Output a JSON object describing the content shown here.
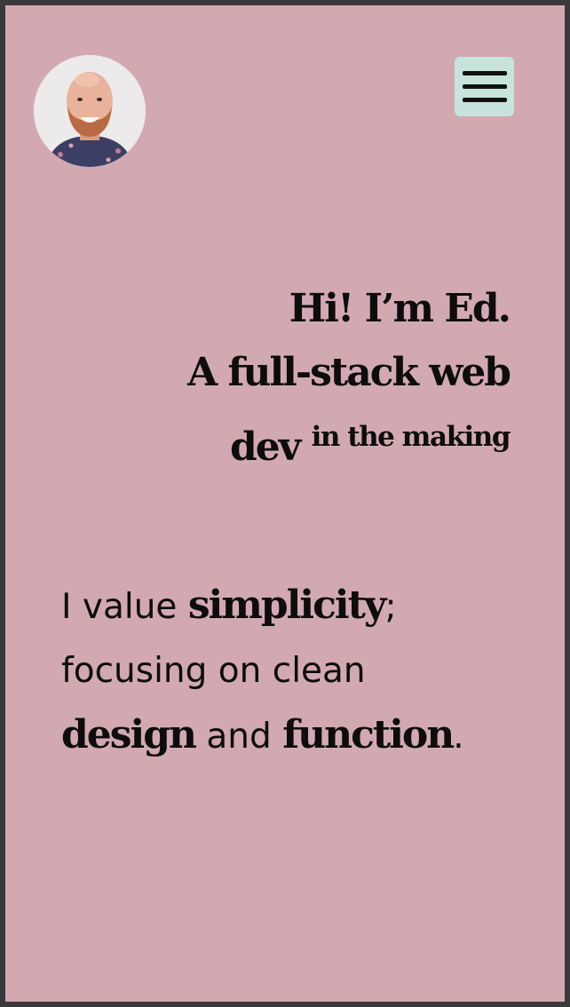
{
  "header": {
    "avatar_alt": "Ed",
    "menu_icon": "hamburger-menu-icon"
  },
  "hero": {
    "line1": "Hi! I’m Ed.",
    "line2": "A full-stack web",
    "line3_main": "dev",
    "line3_small": "in the making"
  },
  "values": {
    "part1": "I value ",
    "word1": "simplicity",
    "part2": ";",
    "part3": "focusing on clean",
    "word2": "design",
    "part4": " and ",
    "word3": "function",
    "part5": "."
  },
  "colors": {
    "background": "#d3a9b1",
    "menu_button": "#c6e4dc",
    "text": "#0d0d0d",
    "outer_frame": "#3a3a3c"
  }
}
